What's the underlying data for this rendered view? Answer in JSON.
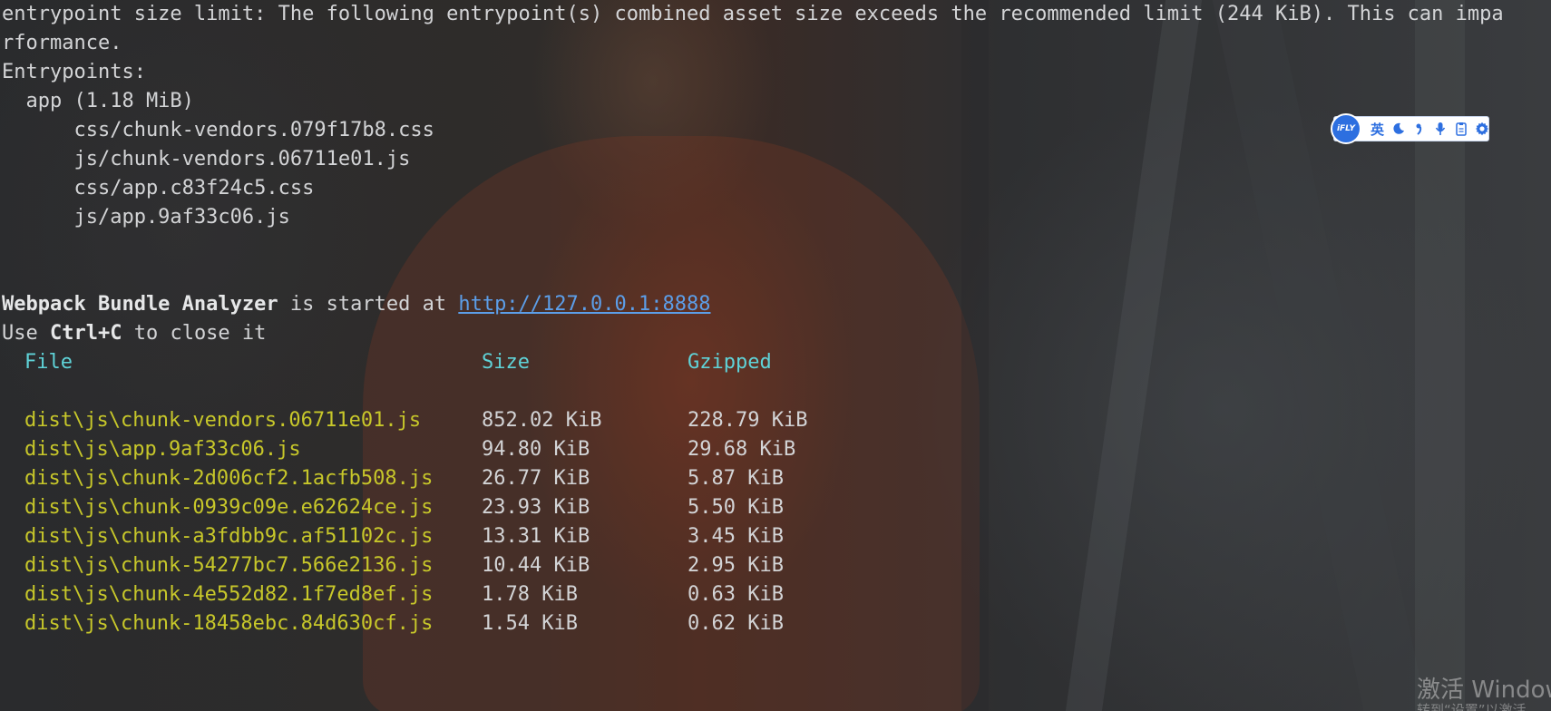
{
  "terminal": {
    "warning_line1": "entrypoint size limit: The following entrypoint(s) combined asset size exceeds the recommended limit (244 KiB). This can impa",
    "warning_line2": "rformance.",
    "entrypoints_label": "Entrypoints:",
    "app_entry": "  app (1.18 MiB)",
    "entry_files": [
      "      css/chunk-vendors.079f17b8.css",
      "      js/chunk-vendors.06711e01.js",
      "      css/app.c83f24c5.css",
      "      js/app.9af33c06.js"
    ],
    "analyzer_name": "Webpack Bundle Analyzer",
    "analyzer_started_text": " is started at ",
    "analyzer_url": "http://127.0.0.1:8888",
    "use_text": "Use ",
    "shortcut": "Ctrl+C",
    "close_text": " to close it",
    "table": {
      "headers": {
        "file": "File",
        "size": "Size",
        "gzipped": "Gzipped"
      },
      "rows": [
        {
          "file": "dist\\js\\chunk-vendors.06711e01.js",
          "size": "852.02 KiB",
          "gzipped": "228.79 KiB"
        },
        {
          "file": "dist\\js\\app.9af33c06.js",
          "size": "94.80 KiB",
          "gzipped": "29.68 KiB"
        },
        {
          "file": "dist\\js\\chunk-2d006cf2.1acfb508.js",
          "size": "26.77 KiB",
          "gzipped": "5.87 KiB"
        },
        {
          "file": "dist\\js\\chunk-0939c09e.e62624ce.js",
          "size": "23.93 KiB",
          "gzipped": "5.50 KiB"
        },
        {
          "file": "dist\\js\\chunk-a3fdbb9c.af51102c.js",
          "size": "13.31 KiB",
          "gzipped": "3.45 KiB"
        },
        {
          "file": "dist\\js\\chunk-54277bc7.566e2136.js",
          "size": "10.44 KiB",
          "gzipped": "2.95 KiB"
        },
        {
          "file": "dist\\js\\chunk-4e552d82.1f7ed8ef.js",
          "size": "1.78 KiB",
          "gzipped": "0.63 KiB"
        },
        {
          "file": "dist\\js\\chunk-18458ebc.84d630cf.js",
          "size": "1.54 KiB",
          "gzipped": "0.62 KiB"
        }
      ]
    }
  },
  "ifly_toolbar": {
    "logo_text": "iFLY",
    "lang_label": "英",
    "items": [
      "moon-icon",
      "comma-icon",
      "microphone-icon",
      "clipboard-icon",
      "gear-icon"
    ]
  },
  "watermark": {
    "title": "激活 Windows",
    "subtitle": "转到“设置”以激活"
  },
  "colors": {
    "text": "#d3d4d6",
    "link": "#5c9ee8",
    "header": "#5fd3d8",
    "file_name": "#c7c72a",
    "ifly_blue": "#2d6fe0"
  }
}
